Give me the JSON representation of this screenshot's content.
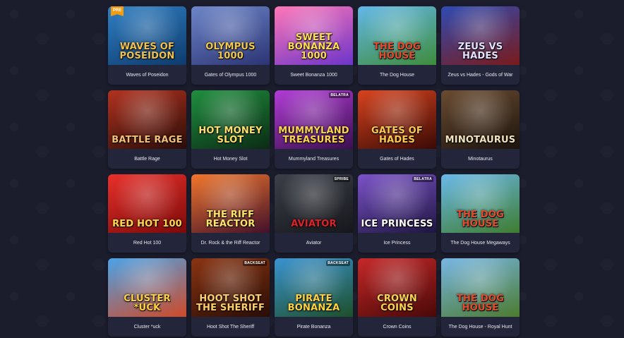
{
  "games": [
    {
      "name": "Waves of Poseidon",
      "art_text": "Waves of Poseidon",
      "provider": "",
      "badge": "PRE",
      "colors": [
        "#2f7fc4",
        "#0e3b6c"
      ],
      "accent": "#f2c14e"
    },
    {
      "name": "Gates of Olympus 1000",
      "art_text": "Olympus 1000",
      "provider": "",
      "badge": "",
      "colors": [
        "#6d86c9",
        "#2c3474"
      ],
      "accent": "#f2c94c"
    },
    {
      "name": "Sweet Bonanza 1000",
      "art_text": "Sweet Bonanza 1000",
      "provider": "",
      "badge": "",
      "colors": [
        "#ff77b7",
        "#6c35c9"
      ],
      "accent": "#ffdd55"
    },
    {
      "name": "The Dog House",
      "art_text": "The Dog House",
      "provider": "",
      "badge": "",
      "colors": [
        "#62b8e8",
        "#3f8c3b"
      ],
      "accent": "#e44c2c"
    },
    {
      "name": "Zeus vs Hades - Gods of War",
      "art_text": "Zeus vs Hades",
      "provider": "",
      "badge": "",
      "colors": [
        "#2f4bb3",
        "#7a1b1b"
      ],
      "accent": "#e3e3ff"
    },
    {
      "name": "Battle Rage",
      "art_text": "Battle Rage",
      "provider": "",
      "badge": "",
      "colors": [
        "#b2321f",
        "#2a0d08"
      ],
      "accent": "#f3c07a"
    },
    {
      "name": "Hot Money Slot",
      "art_text": "Hot Money Slot",
      "provider": "",
      "badge": "",
      "colors": [
        "#1f8f3f",
        "#0b2b14"
      ],
      "accent": "#ffe066"
    },
    {
      "name": "Mummyland Treasures",
      "art_text": "Mummyland Treasures",
      "provider": "BELATRA",
      "badge": "",
      "colors": [
        "#b13cd6",
        "#3b0f4f"
      ],
      "accent": "#ffd34d"
    },
    {
      "name": "Gates of Hades",
      "art_text": "Gates of Hades",
      "provider": "",
      "badge": "",
      "colors": [
        "#d8431e",
        "#3a0a05"
      ],
      "accent": "#ffc94d"
    },
    {
      "name": "Minotaurus",
      "art_text": "Minotaurus",
      "provider": "",
      "badge": "",
      "colors": [
        "#6a4b31",
        "#1c140d"
      ],
      "accent": "#f2e3c0"
    },
    {
      "name": "Red Hot 100",
      "art_text": "Red Hot 100",
      "provider": "",
      "badge": "",
      "colors": [
        "#e9302a",
        "#7a0a0a"
      ],
      "accent": "#ffd84a"
    },
    {
      "name": "Dr. Rock & the Riff Reactor",
      "art_text": "The Riff Reactor",
      "provider": "",
      "badge": "",
      "colors": [
        "#f2762b",
        "#42112a"
      ],
      "accent": "#ffe36a"
    },
    {
      "name": "Aviator",
      "art_text": "Aviator",
      "provider": "SPRIBE",
      "badge": "",
      "colors": [
        "#3c3f48",
        "#15171c"
      ],
      "accent": "#e2202a"
    },
    {
      "name": "Ice Princess",
      "art_text": "Ice Princess",
      "provider": "BELATRA",
      "badge": "",
      "colors": [
        "#7b52c9",
        "#1e1640"
      ],
      "accent": "#ffffff"
    },
    {
      "name": "The Dog House Megaways",
      "art_text": "The Dog House",
      "provider": "",
      "badge": "",
      "colors": [
        "#69b9ea",
        "#3f7c2f"
      ],
      "accent": "#e44c2c"
    },
    {
      "name": "Cluster *uck",
      "art_text": "Cluster *uck",
      "provider": "",
      "badge": "",
      "colors": [
        "#4aa3e8",
        "#cf4a28"
      ],
      "accent": "#ffd23f"
    },
    {
      "name": "Hoot Shot The Sheriff",
      "art_text": "Hoot Shot The Sheriff",
      "provider": "BACKSEAT",
      "badge": "",
      "colors": [
        "#8a3412",
        "#2a0d05"
      ],
      "accent": "#ffcf6a"
    },
    {
      "name": "Pirate Bonanza",
      "art_text": "Pirate Bonanza",
      "provider": "BACKSEAT",
      "badge": "",
      "colors": [
        "#3a93d1",
        "#1d4f2a"
      ],
      "accent": "#ffd23f"
    },
    {
      "name": "Crown Coins",
      "art_text": "Crown Coins",
      "provider": "",
      "badge": "",
      "colors": [
        "#c62828",
        "#4a0808"
      ],
      "accent": "#ffd54f"
    },
    {
      "name": "The Dog House - Royal Hunt",
      "art_text": "The Dog House",
      "provider": "",
      "badge": "",
      "colors": [
        "#77b6e6",
        "#4c7b2e"
      ],
      "accent": "#e44c2c"
    }
  ]
}
